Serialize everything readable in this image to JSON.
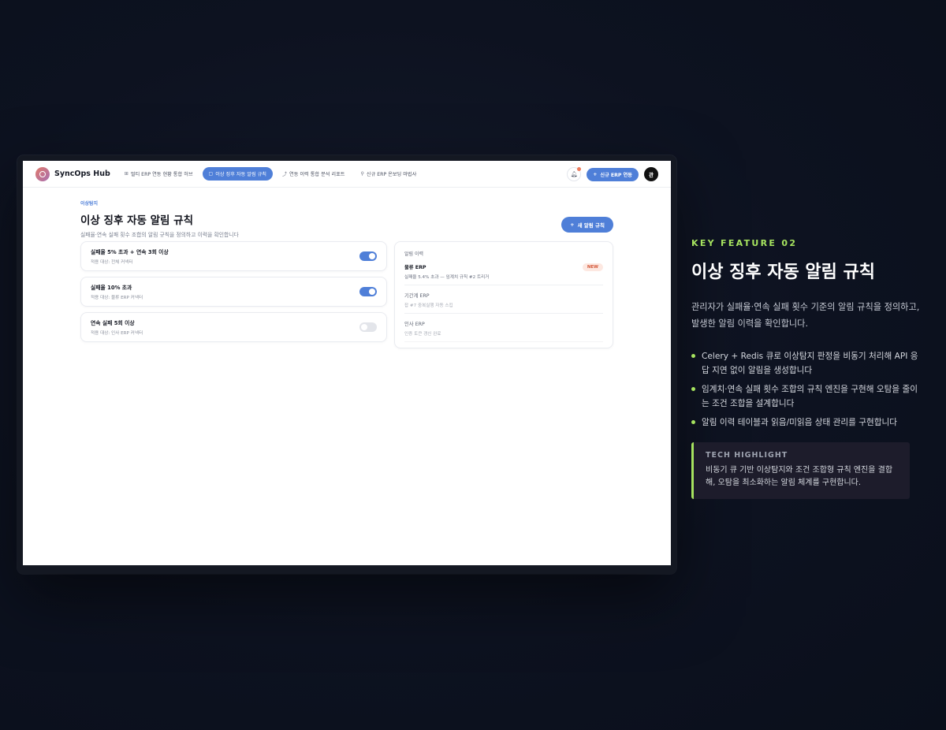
{
  "app": {
    "brand": "SyncOps Hub",
    "nav_tabs": [
      {
        "label": "멀티 ERP 연동 현황 통합 허브",
        "icon": "grid-icon"
      },
      {
        "label": "이상 징후 자동 알림 규칙",
        "icon": "message-icon"
      },
      {
        "label": "연동 이력 통합 분석 리포트",
        "icon": "chart-icon"
      },
      {
        "label": "신규 ERP 온보딩 마법사",
        "icon": "plug-icon"
      }
    ],
    "connect_button": "신규 ERP 연동",
    "avatar_initial": "관"
  },
  "page": {
    "eyebrow": "이상탐지",
    "title": "이상 징후 자동 알림 규칙",
    "subtitle": "실패율·연속 실패 횟수 조합의 알림 규칙을 정의하고 이력을 확인합니다",
    "new_rule_button": "새 알림 규칙"
  },
  "rules": [
    {
      "name": "실패율 5% 초과 + 연속 3회 이상",
      "target": "적용 대상: 전체 커넥터",
      "enabled": true
    },
    {
      "name": "실패율 10% 초과",
      "target": "적용 대상: 물류 ERP 커넥터",
      "enabled": true
    },
    {
      "name": "연속 실패 5회 이상",
      "target": "적용 대상: 인사 ERP 커넥터",
      "enabled": false
    }
  ],
  "history": {
    "title": "알림 이력",
    "items": [
      {
        "name": "물류 ERP",
        "desc": "실패율 5.4% 초과 — 임계치 규칙 #2 트리거",
        "badge": "NEW",
        "read": false
      },
      {
        "name": "기간계 ERP",
        "desc": "잡 #7 중복실행 자동 스킵",
        "badge": "",
        "read": true
      },
      {
        "name": "인사 ERP",
        "desc": "인증 토큰 갱신 완료",
        "badge": "",
        "read": true
      }
    ]
  },
  "feature": {
    "tag": "KEY FEATURE 02",
    "title": "이상 징후 자동 알림 규칙",
    "description": "관리자가 실패율·연속 실패 횟수 기준의 알림 규칙을 정의하고, 발생한 알림 이력을 확인합니다.",
    "bullets": [
      "Celery + Redis 큐로 이상탐지 판정을 비동기 처리해 API 응답 지연 없이 알림을 생성합니다",
      "임계치·연속 실패 횟수 조합의 규칙 엔진을 구현해 오탐을 줄이는 조건 조합을 설계합니다",
      "알림 이력 테이블과 읽음/미읽음 상태 관리를 구현합니다"
    ],
    "tech_title": "TECH HIGHLIGHT",
    "tech_text": "비동기 큐 기반 이상탐지와 조건 조합형 규칙 엔진을 결합해, 오탐을 최소화하는 알림 체계를 구현합니다."
  },
  "colors": {
    "accent_blue": "#4f7fd8",
    "accent_green": "#a6e35f",
    "badge_red": "#d45a3c"
  }
}
